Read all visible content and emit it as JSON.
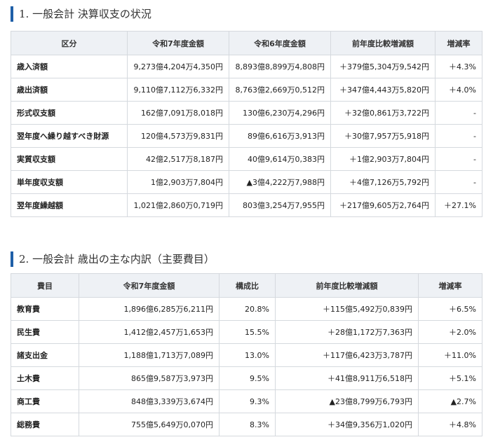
{
  "section1": {
    "title": "1. 一般会計 決算収支の状況",
    "headers": [
      "区分",
      "令和7年度金額",
      "令和6年度金額",
      "前年度比較増減額",
      "増減率"
    ],
    "rows": [
      [
        "歳入済額",
        "9,273億4,204万4,350円",
        "8,893億8,899万4,808円",
        "＋379億5,304万9,542円",
        "＋4.3%"
      ],
      [
        "歳出済額",
        "9,110億7,112万6,332円",
        "8,763億2,669万0,512円",
        "＋347億4,443万5,820円",
        "＋4.0%"
      ],
      [
        "形式収支額",
        "162億7,091万8,018円",
        "130億6,230万4,296円",
        "＋32億0,861万3,722円",
        "-"
      ],
      [
        "翌年度へ繰り越すべき財源",
        "120億4,573万9,831円",
        "89億6,616万3,913円",
        "＋30億7,957万5,918円",
        "-"
      ],
      [
        "実質収支額",
        "42億2,517万8,187円",
        "40億9,614万0,383円",
        "＋1億2,903万7,804円",
        "-"
      ],
      [
        "単年度収支額",
        "1億2,903万7,804円",
        "▲3億4,222万7,988円",
        "＋4億7,126万5,792円",
        "-"
      ],
      [
        "翌年度繰越額",
        "1,021億2,860万0,719円",
        "803億3,254万7,955円",
        "＋217億9,605万2,764円",
        "＋27.1%"
      ]
    ]
  },
  "section2": {
    "title": "2. 一般会計 歳出の主な内訳（主要費目）",
    "headers": [
      "費目",
      "令和7年度金額",
      "構成比",
      "前年度比較増減額",
      "増減率"
    ],
    "rows": [
      [
        "教育費",
        "1,896億6,285万6,211円",
        "20.8%",
        "＋115億5,492万0,839円",
        "＋6.5%"
      ],
      [
        "民生費",
        "1,412億2,457万1,653円",
        "15.5%",
        "＋28億1,172万7,363円",
        "＋2.0%"
      ],
      [
        "諸支出金",
        "1,188億1,713万7,089円",
        "13.0%",
        "＋117億6,423万3,787円",
        "＋11.0%"
      ],
      [
        "土木費",
        "865億9,587万3,973円",
        "9.5%",
        "＋41億8,911万6,518円",
        "＋5.1%"
      ],
      [
        "商工費",
        "848億3,339万3,674円",
        "9.3%",
        "▲23億8,799万6,793円",
        "▲2.7%"
      ],
      [
        "総務費",
        "755億5,649万0,070円",
        "8.3%",
        "＋34億9,356万1,020円",
        "＋4.8%"
      ]
    ]
  }
}
